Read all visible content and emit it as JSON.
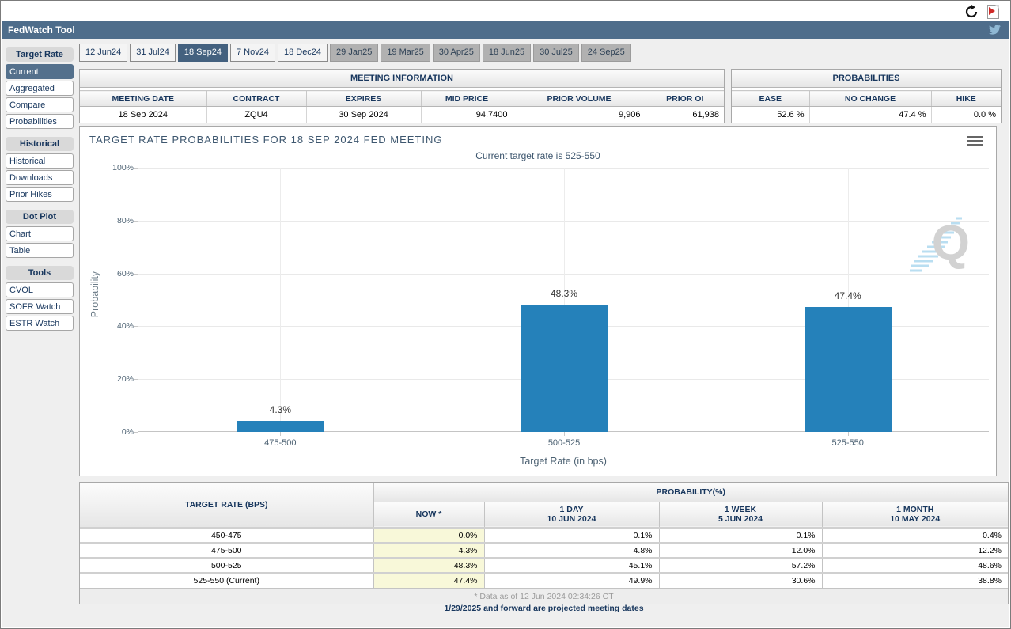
{
  "window": {
    "refresh_icon": "refresh-icon",
    "pdf_export_icon": "pdf-export-icon"
  },
  "app_header": {
    "title": "FedWatch Tool",
    "twitter_icon": "twitter-bird-icon"
  },
  "tabs": {
    "selected": "18 Sep24",
    "items": [
      {
        "label": "12 Jun24",
        "state": "enabled"
      },
      {
        "label": "31 Jul24",
        "state": "enabled"
      },
      {
        "label": "18 Sep24",
        "state": "selected"
      },
      {
        "label": "7 Nov24",
        "state": "enabled"
      },
      {
        "label": "18 Dec24",
        "state": "enabled"
      },
      {
        "label": "29 Jan25",
        "state": "disabled"
      },
      {
        "label": "19 Mar25",
        "state": "disabled"
      },
      {
        "label": "30 Apr25",
        "state": "disabled"
      },
      {
        "label": "18 Jun25",
        "state": "disabled"
      },
      {
        "label": "30 Jul25",
        "state": "disabled"
      },
      {
        "label": "24 Sep25",
        "state": "disabled"
      }
    ]
  },
  "sidebar": {
    "sections": [
      {
        "title": "Target Rate",
        "items": [
          {
            "label": "Current",
            "selected": true
          },
          {
            "label": "Aggregated",
            "selected": false
          },
          {
            "label": "Compare",
            "selected": false
          },
          {
            "label": "Probabilities",
            "selected": false
          }
        ]
      },
      {
        "title": "Historical",
        "items": [
          {
            "label": "Historical",
            "selected": false
          },
          {
            "label": "Downloads",
            "selected": false
          },
          {
            "label": "Prior Hikes",
            "selected": false
          }
        ]
      },
      {
        "title": "Dot Plot",
        "items": [
          {
            "label": "Chart",
            "selected": false
          },
          {
            "label": "Table",
            "selected": false
          }
        ]
      },
      {
        "title": "Tools",
        "items": [
          {
            "label": "CVOL",
            "selected": false
          },
          {
            "label": "SOFR Watch",
            "selected": false
          },
          {
            "label": "ESTR Watch",
            "selected": false
          }
        ]
      }
    ]
  },
  "meeting_info": {
    "title": "MEETING INFORMATION",
    "columns": [
      "MEETING DATE",
      "CONTRACT",
      "EXPIRES",
      "MID PRICE",
      "PRIOR VOLUME",
      "PRIOR OI"
    ],
    "row": [
      "18 Sep 2024",
      "ZQU4",
      "30 Sep 2024",
      "94.7400",
      "9,906",
      "61,938"
    ]
  },
  "probabilities_summary": {
    "title": "PROBABILITIES",
    "columns": [
      "EASE",
      "NO CHANGE",
      "HIKE"
    ],
    "row": [
      "52.6 %",
      "47.4 %",
      "0.0 %"
    ]
  },
  "chart_data": {
    "type": "bar",
    "title": "TARGET RATE PROBABILITIES FOR 18 SEP 2024 FED MEETING",
    "subtitle": "Current target rate is 525-550",
    "categories": [
      "475-500",
      "500-525",
      "525-550"
    ],
    "values": [
      4.3,
      48.3,
      47.4
    ],
    "bar_labels": [
      "4.3%",
      "48.3%",
      "47.4%"
    ],
    "xlabel": "Target Rate (in bps)",
    "ylabel": "Probability",
    "ylim": [
      0,
      100
    ],
    "yticks": [
      "0%",
      "20%",
      "40%",
      "60%",
      "80%",
      "100%"
    ],
    "grid": true,
    "legend": false,
    "bar_color": "#2581ba",
    "watermark": "Q",
    "menu_icon": "hamburger-menu-icon"
  },
  "prob_table": {
    "col1_header": "TARGET RATE (BPS)",
    "group_header": "PROBABILITY(%)",
    "columns": [
      {
        "line1": "NOW *",
        "line2": ""
      },
      {
        "line1": "1 DAY",
        "line2": "10 JUN 2024"
      },
      {
        "line1": "1 WEEK",
        "line2": "5 JUN 2024"
      },
      {
        "line1": "1 MONTH",
        "line2": "10 MAY 2024"
      }
    ],
    "rows": [
      {
        "rate": "450-475",
        "now": "0.0%",
        "day": "0.1%",
        "week": "0.1%",
        "month": "0.4%"
      },
      {
        "rate": "475-500",
        "now": "4.3%",
        "day": "4.8%",
        "week": "12.0%",
        "month": "12.2%"
      },
      {
        "rate": "500-525",
        "now": "48.3%",
        "day": "45.1%",
        "week": "57.2%",
        "month": "48.6%"
      },
      {
        "rate": "525-550 (Current)",
        "now": "47.4%",
        "day": "49.9%",
        "week": "30.6%",
        "month": "38.8%"
      }
    ],
    "footnote": "* Data as of 12 Jun 2024 02:34:26 CT"
  },
  "notes": {
    "projected": "1/29/2025 and forward are projected meeting dates"
  },
  "colors": {
    "app_bar": "#4e6d8b",
    "selected_tab": "#44617f",
    "selected_sidebar": "#54708c",
    "bar_blue": "#2581ba",
    "now_column_highlight": "#f8f8d9",
    "disabled_tab": "#b1b1b1"
  }
}
